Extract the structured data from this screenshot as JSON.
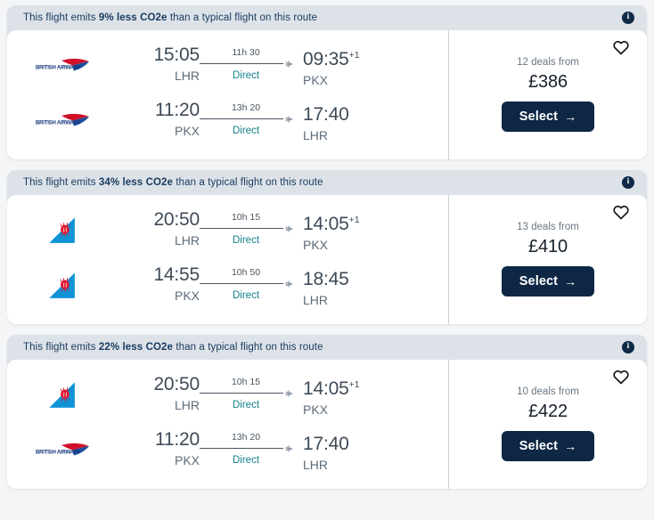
{
  "page": {
    "background_color": "#f4f5f7",
    "accent_color": "#0d2744",
    "stops_color": "#13818b",
    "banner_color": "#dde2e8"
  },
  "cards": [
    {
      "eco": {
        "prefix": "This flight emits ",
        "highlight": "9% less CO2e",
        "suffix": " than a typical flight on this route",
        "info_icon": "info-icon"
      },
      "legs": [
        {
          "airline": "British Airways",
          "airline_logo": "british-airways-logo",
          "depart_time": "15:05",
          "depart_day_offset": "",
          "depart_airport": "LHR",
          "duration": "11h 30",
          "stops": "Direct",
          "arrive_time": "09:35",
          "arrive_day_offset": "+1",
          "arrive_airport": "PKX"
        },
        {
          "airline": "British Airways",
          "airline_logo": "british-airways-logo",
          "depart_time": "11:20",
          "depart_day_offset": "",
          "depart_airport": "PKX",
          "duration": "13h 20",
          "stops": "Direct",
          "arrive_time": "17:40",
          "arrive_day_offset": "",
          "arrive_airport": "LHR"
        }
      ],
      "price": {
        "deals": "12 deals from",
        "amount": "£386",
        "select_label": "Select",
        "select_arrow": "→",
        "favourite_icon": "heart-icon"
      }
    },
    {
      "eco": {
        "prefix": "This flight emits ",
        "highlight": "34% less CO2e",
        "suffix": " than a typical flight on this route",
        "info_icon": "info-icon"
      },
      "legs": [
        {
          "airline": "China Southern Airlines",
          "airline_logo": "china-southern-logo",
          "depart_time": "20:50",
          "depart_day_offset": "",
          "depart_airport": "LHR",
          "duration": "10h 15",
          "stops": "Direct",
          "arrive_time": "14:05",
          "arrive_day_offset": "+1",
          "arrive_airport": "PKX"
        },
        {
          "airline": "China Southern Airlines",
          "airline_logo": "china-southern-logo",
          "depart_time": "14:55",
          "depart_day_offset": "",
          "depart_airport": "PKX",
          "duration": "10h 50",
          "stops": "Direct",
          "arrive_time": "18:45",
          "arrive_day_offset": "",
          "arrive_airport": "LHR"
        }
      ],
      "price": {
        "deals": "13 deals from",
        "amount": "£410",
        "select_label": "Select",
        "select_arrow": "→",
        "favourite_icon": "heart-icon"
      }
    },
    {
      "eco": {
        "prefix": "This flight emits ",
        "highlight": "22% less CO2e",
        "suffix": " than a typical flight on this route",
        "info_icon": "info-icon"
      },
      "legs": [
        {
          "airline": "China Southern Airlines",
          "airline_logo": "china-southern-logo",
          "depart_time": "20:50",
          "depart_day_offset": "",
          "depart_airport": "LHR",
          "duration": "10h 15",
          "stops": "Direct",
          "arrive_time": "14:05",
          "arrive_day_offset": "+1",
          "arrive_airport": "PKX"
        },
        {
          "airline": "British Airways",
          "airline_logo": "british-airways-logo",
          "depart_time": "11:20",
          "depart_day_offset": "",
          "depart_airport": "PKX",
          "duration": "13h 20",
          "stops": "Direct",
          "arrive_time": "17:40",
          "arrive_day_offset": "",
          "arrive_airport": "LHR"
        }
      ],
      "price": {
        "deals": "10 deals from",
        "amount": "£422",
        "select_label": "Select",
        "select_arrow": "→",
        "favourite_icon": "heart-icon"
      }
    }
  ]
}
